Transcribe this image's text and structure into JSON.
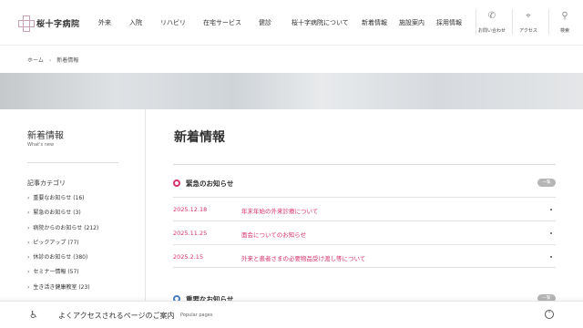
{
  "header": {
    "logo_text": "桜十字病院",
    "nav": [
      "外来",
      "入院",
      "リハビリ",
      "在宅サービス",
      "健診",
      "桜十字病院について",
      "新着情報",
      "施設案内",
      "採用情報"
    ],
    "utilities": [
      {
        "label": "お問い合わせ",
        "icon": "phone-icon"
      },
      {
        "label": "アクセス",
        "icon": "map-pin-icon"
      },
      {
        "label": "検索",
        "icon": "search-icon"
      }
    ]
  },
  "breadcrumb": {
    "home": "ホーム",
    "current": "新着情報"
  },
  "sidebar": {
    "title": "新着情報",
    "subtitle": "What's new",
    "category_title": "記事カテゴリ",
    "categories": [
      "重要なお知らせ (16)",
      "緊急のお知らせ (3)",
      "病院からのお知らせ (212)",
      "ピックアップ (77)",
      "休診のお知らせ (380)",
      "セミナー情報 (57)",
      "生き活き健康教室 (23)"
    ]
  },
  "main": {
    "title": "新着情報",
    "sections": [
      {
        "label": "緊急のお知らせ",
        "badge": "一覧",
        "items": [
          {
            "date": "2025.12.18",
            "title": "年末年始の外来診療について"
          },
          {
            "date": "2025.11.25",
            "title": "面会についてのお知らせ"
          },
          {
            "date": "2025.2.15",
            "title": "外来と患者さまの必要物品受け渡し等について"
          }
        ]
      },
      {
        "label": "重要なお知らせ",
        "badge": "一覧"
      }
    ]
  },
  "footer": {
    "text": "よくアクセスされるページのご案内",
    "sub": "Popular pages"
  },
  "colors": {
    "accent": "#d6336c",
    "secondary": "#4a7fc1"
  }
}
